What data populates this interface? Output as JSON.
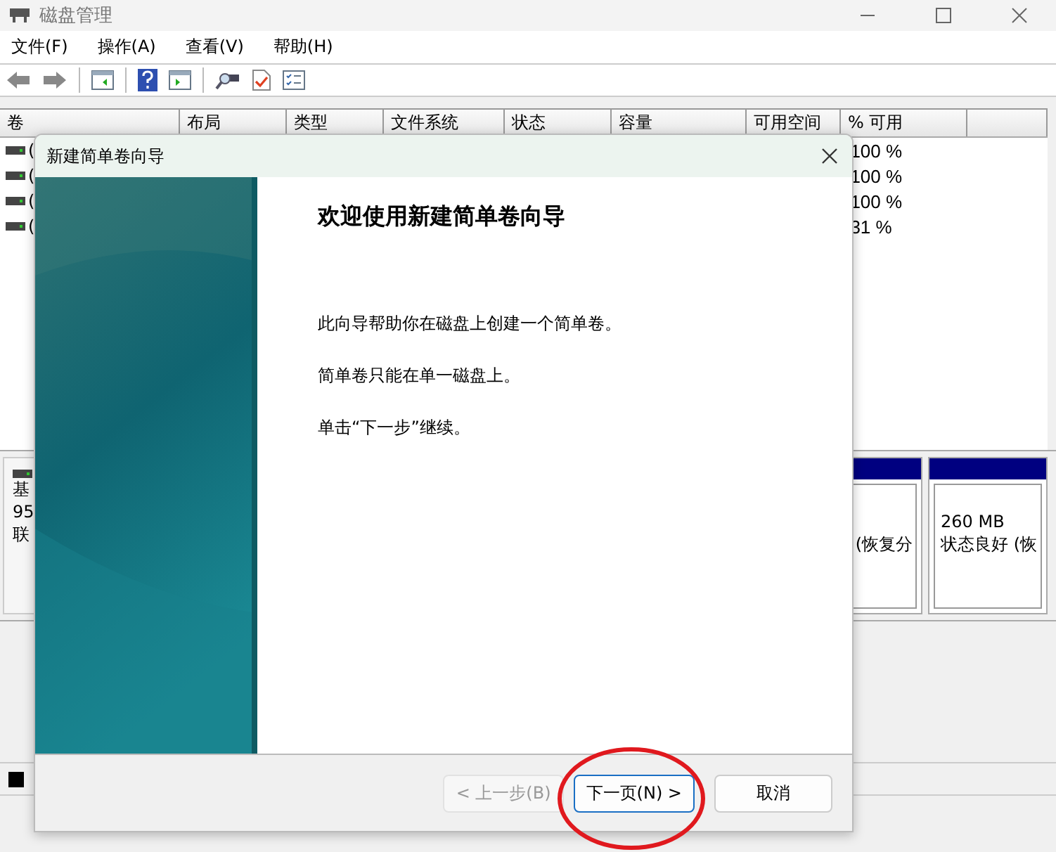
{
  "app": {
    "title": "磁盘管理",
    "menu": [
      "文件(F)",
      "操作(A)",
      "查看(V)",
      "帮助(H)"
    ]
  },
  "volume_table": {
    "columns": [
      "卷",
      "布局",
      "类型",
      "文件系统",
      "状态",
      "容量",
      "可用空间",
      "% 可用"
    ],
    "rows": [
      {
        "volume": "(",
        "percent_free": "100 %"
      },
      {
        "volume": "(",
        "percent_free": "100 %"
      },
      {
        "volume": "(",
        "percent_free": "100 %"
      },
      {
        "volume": "(",
        "percent_free": "31 %"
      }
    ]
  },
  "disk_pane": {
    "disk_info": [
      "基",
      "95",
      "联"
    ],
    "partitions": [
      {
        "lines": [
          "(恢复分"
        ]
      },
      {
        "lines": [
          "260 MB",
          "状态良好 (恢"
        ]
      }
    ]
  },
  "wizard": {
    "title": "新建简单卷向导",
    "heading": "欢迎使用新建简单卷向导",
    "paragraphs": [
      "此向导帮助你在磁盘上创建一个简单卷。",
      "简单卷只能在单一磁盘上。",
      "单击“下一步”继续。"
    ],
    "buttons": [
      {
        "label": "< 上一步(B)",
        "disabled": true,
        "default": false
      },
      {
        "label": "下一页(N) >",
        "disabled": false,
        "default": true
      },
      {
        "label": "取消",
        "disabled": false,
        "default": false
      }
    ]
  }
}
